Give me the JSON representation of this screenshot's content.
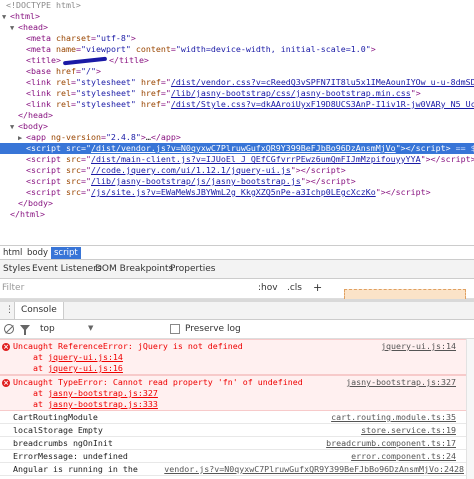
{
  "elements_tree": {
    "doctype": "<!DOCTYPE html>",
    "html_open": "<html>",
    "head_open": "<head>",
    "meta_charset": {
      "name": "charset",
      "value": "\"utf-8\""
    },
    "meta_viewport": {
      "name": "name",
      "value": "\"viewport\"",
      "content_attr": "content",
      "content_value": "\"width=device-width, initial-scale=1.0\""
    },
    "title_open": "<title>",
    "title_close": "</title>",
    "base": {
      "attr": "href",
      "value": "\"/\""
    },
    "links": [
      {
        "href": "/dist/vendor.css?v=cReedQ3vSPFN7IT8lu5x1IMeAounIYOw_u-u-8dmSDA"
      },
      {
        "href": "/lib/jasny-bootstrap/css/jasny-bootstrap.min.css"
      },
      {
        "href": "/dist/Style.css?v=dkAAroiUyxF19D8UCS3AnP-I1iv1R-jw0VARy_N5_Uc"
      }
    ],
    "head_close": "</head>",
    "body_open": "<body>",
    "app": {
      "attr": "ng-version",
      "value": "\"2.4.8\"",
      "ellipsis": "…",
      "close": "</app>"
    },
    "scripts": [
      {
        "src": "/dist/vendor.js?v=N0qyxwC7PlruwGufxQR9Y399BeFJbBo96DzAnsmMjVo"
      },
      {
        "src": "/dist/main-client.js?v=IJUoEl_J_QEfCGfvrrPEwz6umQmFIJmMzpifouyyYYA"
      },
      {
        "src": "//code.jquery.com/ui/1.12.1/jquery-ui.js"
      },
      {
        "src": "/lib/jasny-bootstrap/js/jasny-bootstrap.js"
      },
      {
        "src": "/js/site.js?v=EWaMeWsJBYWmL2g_KkgXZQ5nPe-a3Ichp0LEgcXczKo"
      }
    ],
    "selected_marker": "== $0",
    "body_close": "</body>",
    "html_close": "</html>"
  },
  "breadcrumbs": [
    "html",
    "body",
    "script"
  ],
  "styles_tabs": [
    "Styles",
    "Event Listeners",
    "DOM Breakpoints",
    "Properties"
  ],
  "styles_toolbar": {
    "filter_placeholder": "Filter",
    "hov": ":hov",
    "cls": ".cls",
    "add": "+"
  },
  "console": {
    "drawer_tab": "Console",
    "context": "top",
    "preserve_log_label": "Preserve log",
    "messages": [
      {
        "level": "error",
        "text": "Uncaught ReferenceError: jQuery is not defined",
        "source": "jquery-ui.js:14",
        "stack": [
          {
            "at": "at ",
            "link": "jquery-ui.js:14"
          },
          {
            "at": "at ",
            "link": "jquery-ui.js:16"
          }
        ]
      },
      {
        "level": "error",
        "text": "Uncaught TypeError: Cannot read property 'fn' of undefined",
        "source": "jasny-bootstrap.js:327",
        "stack": [
          {
            "at": "at ",
            "link": "jasny-bootstrap.js:327"
          },
          {
            "at": "at ",
            "link": "jasny-bootstrap.js:333"
          }
        ]
      },
      {
        "level": "log",
        "text": "CartRoutingModule",
        "source": "cart.routing.module.ts:35"
      },
      {
        "level": "log",
        "text": "localStorage Empty",
        "source": "store.service.ts:19"
      },
      {
        "level": "log",
        "text": "breadcrumbs ngOnInit",
        "source": "breadcrumb.component.ts:17"
      },
      {
        "level": "log",
        "text": "ErrorMessage: undefined",
        "source": "error.component.ts:24"
      },
      {
        "level": "log",
        "text": "Angular is running in the",
        "source": "vendor.js?v=N0qyxwC7PlruwGufxQR9Y399BeFJbBo96DzAnsmMjVo:2428"
      }
    ]
  },
  "colors": {
    "selection": "#3875d7",
    "tag": "#881280",
    "attr": "#994500",
    "value": "#1a1aa6",
    "error_bg": "#fff0f0",
    "error_text": "#e00"
  }
}
